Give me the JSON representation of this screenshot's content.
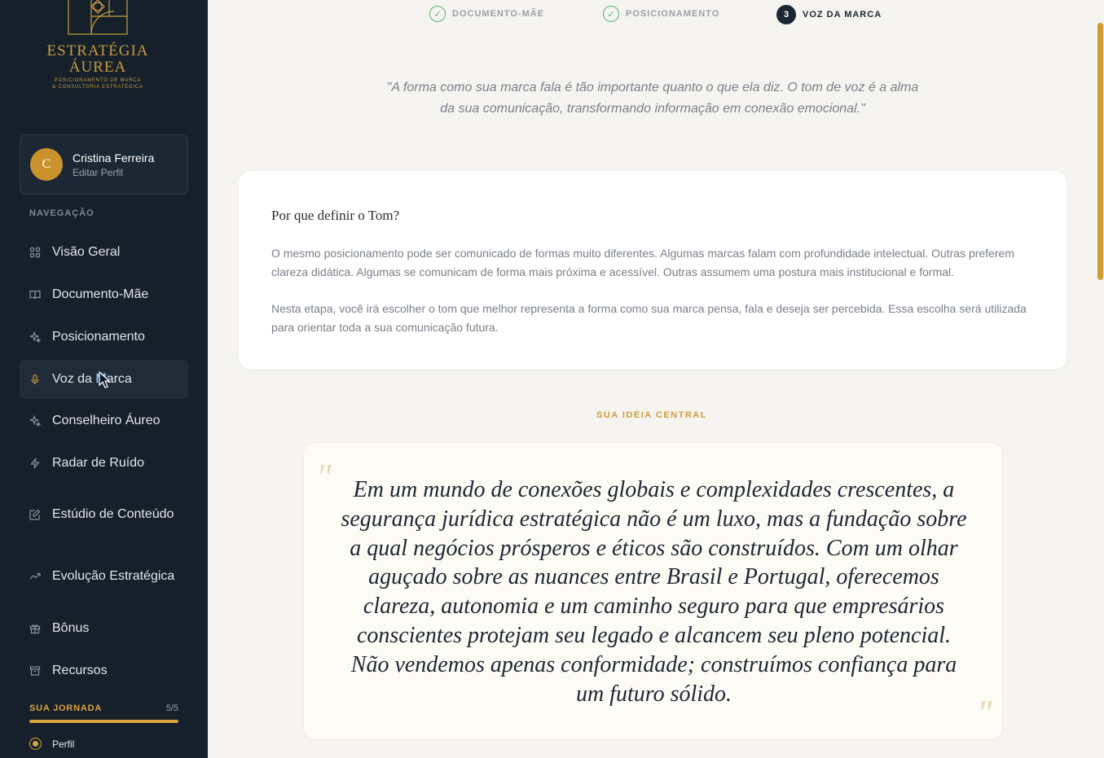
{
  "brand": {
    "title_line1": "ESTRATÉGIA",
    "title_line2": "ÁUREA",
    "subtitle_line1": "POSICIONAMENTO DE MARCA",
    "subtitle_line2": "& CONSULTORIA ESTRATÉGICA",
    "color": "#c99a3e"
  },
  "profile": {
    "initial": "C",
    "name": "Cristina Ferreira",
    "edit_label": "Editar Perfil"
  },
  "nav": {
    "title": "NAVEGAÇÃO",
    "items": [
      {
        "label": "Visão Geral",
        "icon": "grid-icon"
      },
      {
        "label": "Documento-Mãe",
        "icon": "book-icon"
      },
      {
        "label": "Posicionamento",
        "icon": "sparkles-icon"
      },
      {
        "label": "Voz da Marca",
        "icon": "microphone-icon",
        "active": true
      },
      {
        "label": "Conselheiro Áureo",
        "icon": "sparkles-icon"
      },
      {
        "label": "Radar de Ruído",
        "icon": "lightning-icon"
      },
      {
        "label": "Estúdio de Conteúdo",
        "icon": "edit-icon"
      },
      {
        "label": "Evolução Estratégica",
        "icon": "trending-up-icon"
      },
      {
        "label": "Bônus",
        "icon": "gift-icon"
      },
      {
        "label": "Recursos",
        "icon": "archive-icon"
      }
    ]
  },
  "journey": {
    "title": "SUA JORNADA",
    "count": "5/5",
    "progress": 1.0,
    "steps": [
      {
        "label": "Perfil"
      }
    ]
  },
  "stepper": {
    "steps": [
      {
        "label": "DOCUMENTO-MÃE",
        "state": "done",
        "marker": "✓"
      },
      {
        "label": "POSICIONAMENTO",
        "state": "done",
        "marker": "✓"
      },
      {
        "label": "VOZ DA MARCA",
        "state": "current",
        "marker": "3"
      }
    ]
  },
  "intro_quote": "\"A forma como sua marca fala é tão importante quanto o que ela diz. O tom de voz é a alma da sua comunicação, transformando informação em conexão emocional.\"",
  "why_card": {
    "title": "Por que definir o Tom?",
    "paragraph1": "O mesmo posicionamento pode ser comunicado de formas muito diferentes. Algumas marcas falam com profundidade intelectual. Outras preferem clareza didática. Algumas se comunicam de forma mais próxima e acessível. Outras assumem uma postura mais institucional e formal.",
    "paragraph2": "Nesta etapa, você irá escolher o tom que melhor representa a forma como sua marca pensa, fala e deseja ser percebida. Essa escolha será utilizada para orientar toda a sua comunicação futura."
  },
  "central_idea": {
    "label": "SUA IDEIA CENTRAL",
    "open_mark": "\"",
    "close_mark": "\"",
    "text": "Em um mundo de conexões globais e complexidades crescentes, a segurança jurídica estratégica não é um luxo, mas a fundação sobre a qual negócios prósperos e éticos são construídos. Com um olhar aguçado sobre as nuances entre Brasil e Portugal, oferecemos clareza, autonomia e um caminho seguro para que empresários conscientes protejam seu legado e alcancem seu pleno potencial. Não vendemos apenas conformidade; construímos confiança para um futuro sólido."
  },
  "colors": {
    "sidebar_bg": "#15202b",
    "accent": "#d49a3a",
    "success": "#5ab26f",
    "page_bg": "#f5f4f0"
  }
}
